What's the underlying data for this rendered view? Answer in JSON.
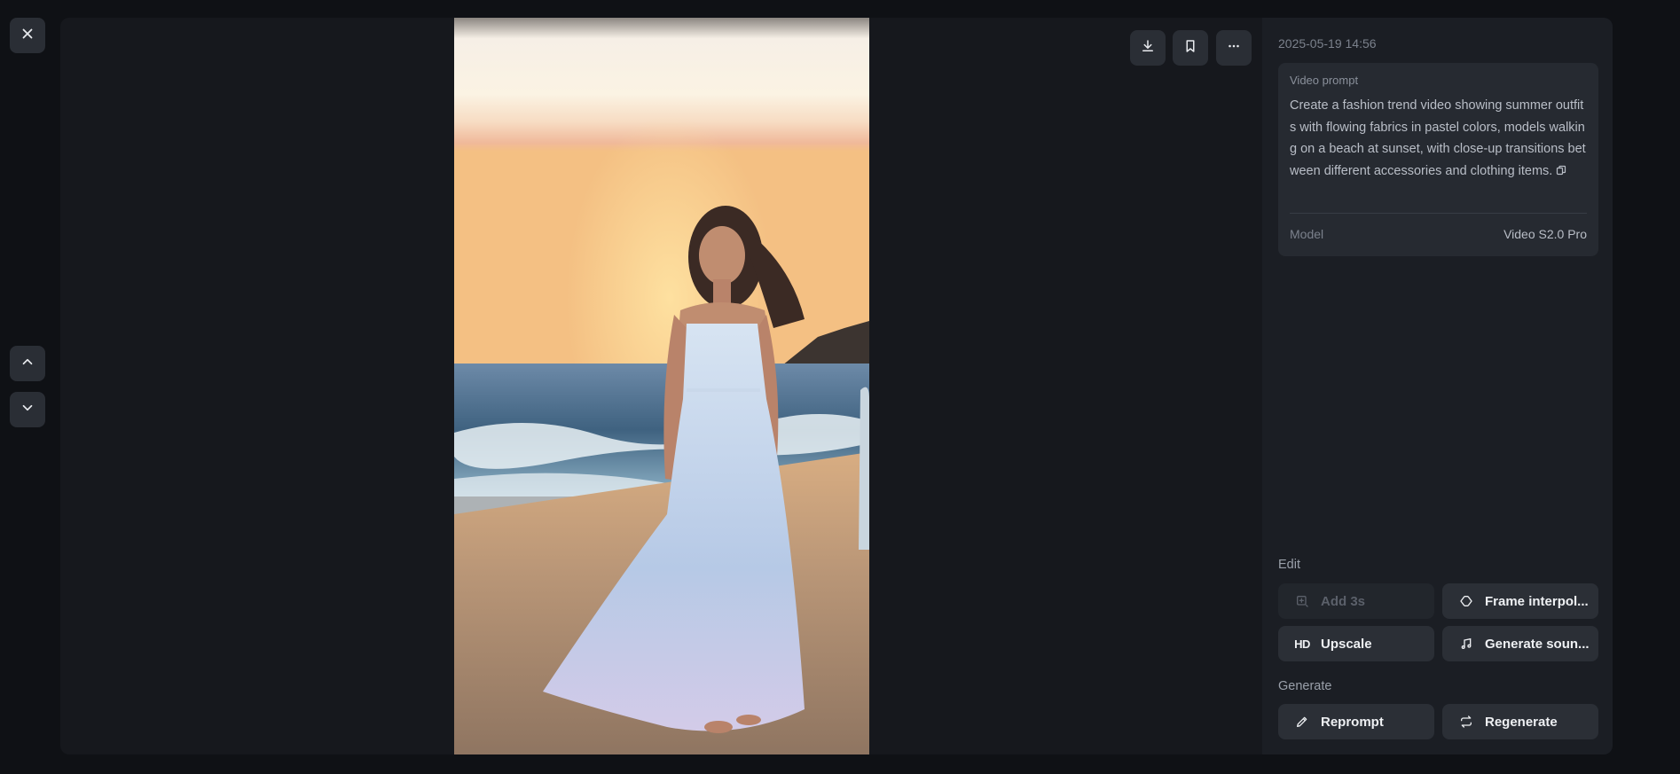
{
  "nav": {
    "close_icon": "close-icon",
    "prev_icon": "chevron-up-icon",
    "next_icon": "chevron-down-icon"
  },
  "toolbar": {
    "download_icon": "download-icon",
    "bookmark_icon": "bookmark-icon",
    "more_icon": "more-horizontal-icon"
  },
  "details": {
    "timestamp": "2025-05-19 14:56",
    "prompt_title": "Video prompt",
    "prompt_text": "Create a fashion trend video showing summer outfits with flowing fabrics in pastel colors, models walking on a beach at sunset, with close-up transitions between different accessories and clothing items.",
    "model_label": "Model",
    "model_value": "Video S2.0 Pro"
  },
  "edit": {
    "label": "Edit",
    "add": "Add 3s",
    "frame": "Frame interpol...",
    "upscale_glyph": "HD",
    "upscale": "Upscale",
    "sound": "Generate soun..."
  },
  "generate": {
    "label": "Generate",
    "reprompt": "Reprompt",
    "regenerate": "Regenerate"
  },
  "colors": {
    "page_bg": "#0f1115",
    "panel_bg": "#1b1e24",
    "button_bg": "#2b2f36"
  }
}
